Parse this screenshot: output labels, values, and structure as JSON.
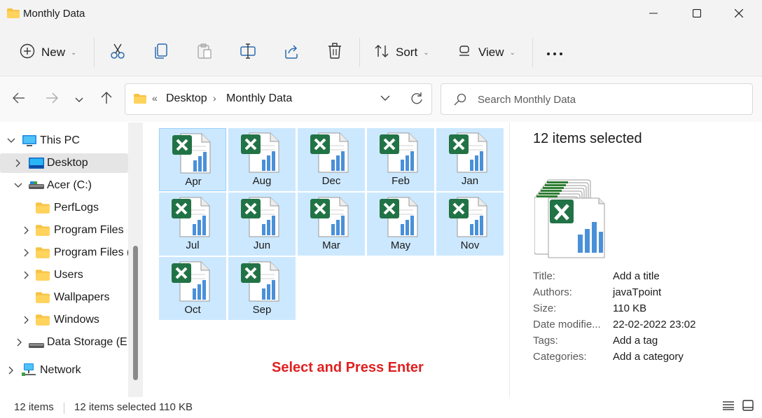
{
  "window": {
    "title": "Monthly Data",
    "icon": "folder-icon",
    "controls": [
      "minimize-icon",
      "maximize-icon",
      "close-icon"
    ]
  },
  "toolbar": {
    "new_label": "New",
    "sort_label": "Sort",
    "view_label": "View",
    "icons": [
      "new-icon",
      "cut-icon",
      "copy-icon",
      "paste-icon",
      "rename-icon",
      "share-icon",
      "delete-icon",
      "sort-icon",
      "view-icon",
      "more-icon"
    ]
  },
  "nav": {
    "breadcrumb_overflow": "«",
    "crumbs": [
      "Desktop",
      "Monthly Data"
    ],
    "separator": "›"
  },
  "search": {
    "placeholder": "Search Monthly Data",
    "value": ""
  },
  "sidebar": {
    "items": [
      {
        "label": "This PC",
        "icon": "pc-icon"
      },
      {
        "label": "Desktop",
        "icon": "desktop-icon",
        "selected": true
      },
      {
        "label": "Acer (C:)",
        "icon": "drive-icon"
      },
      {
        "label": "PerfLogs",
        "icon": "folder-icon"
      },
      {
        "label": "Program Files",
        "icon": "folder-icon"
      },
      {
        "label": "Program Files (",
        "icon": "folder-icon"
      },
      {
        "label": "Users",
        "icon": "folder-icon"
      },
      {
        "label": "Wallpapers",
        "icon": "folder-icon"
      },
      {
        "label": "Windows",
        "icon": "folder-icon"
      },
      {
        "label": "Data Storage (E:)",
        "icon": "drive-icon"
      },
      {
        "label": "Network",
        "icon": "network-icon"
      }
    ]
  },
  "files": [
    {
      "name": "Apr"
    },
    {
      "name": "Aug"
    },
    {
      "name": "Dec"
    },
    {
      "name": "Feb"
    },
    {
      "name": "Jan"
    },
    {
      "name": "Jul"
    },
    {
      "name": "Jun"
    },
    {
      "name": "Mar"
    },
    {
      "name": "May"
    },
    {
      "name": "Nov"
    },
    {
      "name": "Oct"
    },
    {
      "name": "Sep"
    }
  ],
  "hint": "Select and Press Enter",
  "details": {
    "heading": "12 items selected",
    "properties": [
      {
        "label": "Title:",
        "value": "Add a title"
      },
      {
        "label": "Authors:",
        "value": "javaTpoint"
      },
      {
        "label": "Size:",
        "value": "110 KB"
      },
      {
        "label": "Date modifie...",
        "value": "22-02-2022 23:02"
      },
      {
        "label": "Tags:",
        "value": "Add a tag"
      },
      {
        "label": "Categories:",
        "value": "Add a category"
      }
    ]
  },
  "status": {
    "count": "12 items",
    "selection": "12 items selected  110 KB"
  },
  "colors": {
    "selection": "#cce8ff",
    "hint": "#e02020",
    "chrome": "#f3f3f3",
    "excel_green": "#217346"
  }
}
